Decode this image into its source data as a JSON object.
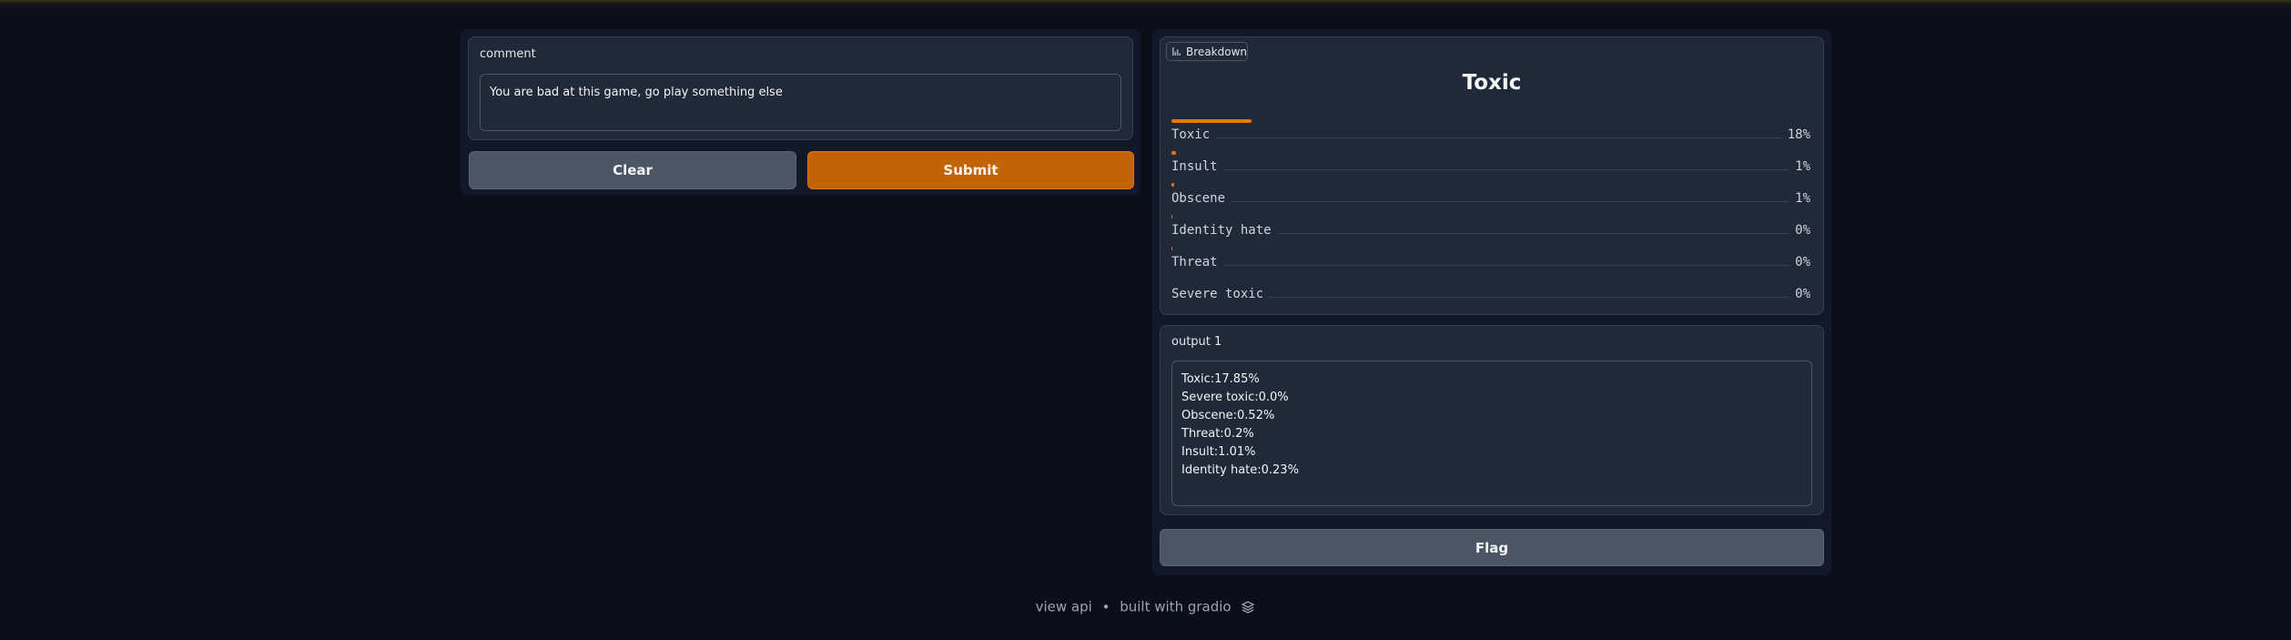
{
  "input": {
    "label": "comment",
    "value": "You are bad at this game, go play something else"
  },
  "buttons": {
    "clear": "Clear",
    "submit": "Submit",
    "flag": "Flag"
  },
  "breakdown": {
    "tab_label": "Breakdown",
    "tab_icon": "bar-chart-icon",
    "title": "Toxic",
    "rows": [
      {
        "label": "Toxic",
        "percent": "18%",
        "fraction": 0.1785
      },
      {
        "label": "Insult",
        "percent": "1%",
        "fraction": 0.0101
      },
      {
        "label": "Obscene",
        "percent": "1%",
        "fraction": 0.0052
      },
      {
        "label": "Identity hate",
        "percent": "0%",
        "fraction": 0.0023
      },
      {
        "label": "Threat",
        "percent": "0%",
        "fraction": 0.002
      },
      {
        "label": "Severe toxic",
        "percent": "0%",
        "fraction": 0.0
      }
    ]
  },
  "output": {
    "label": "output 1",
    "lines": [
      "Toxic:17.85%",
      "Severe toxic:0.0%",
      "Obscene:0.52%",
      "Threat:0.2%",
      "Insult:1.01%",
      "Identity hate:0.23%"
    ]
  },
  "footer": {
    "view_api": "view api",
    "separator": "•",
    "built_with": "built with gradio",
    "logo_icon": "gradio-logo-icon"
  },
  "colors": {
    "background": "#0b0f19",
    "panel": "#111827",
    "block": "#1f2937",
    "primary": "#c2630a",
    "secondary": "#4b5563",
    "bar": "#e07b14"
  }
}
